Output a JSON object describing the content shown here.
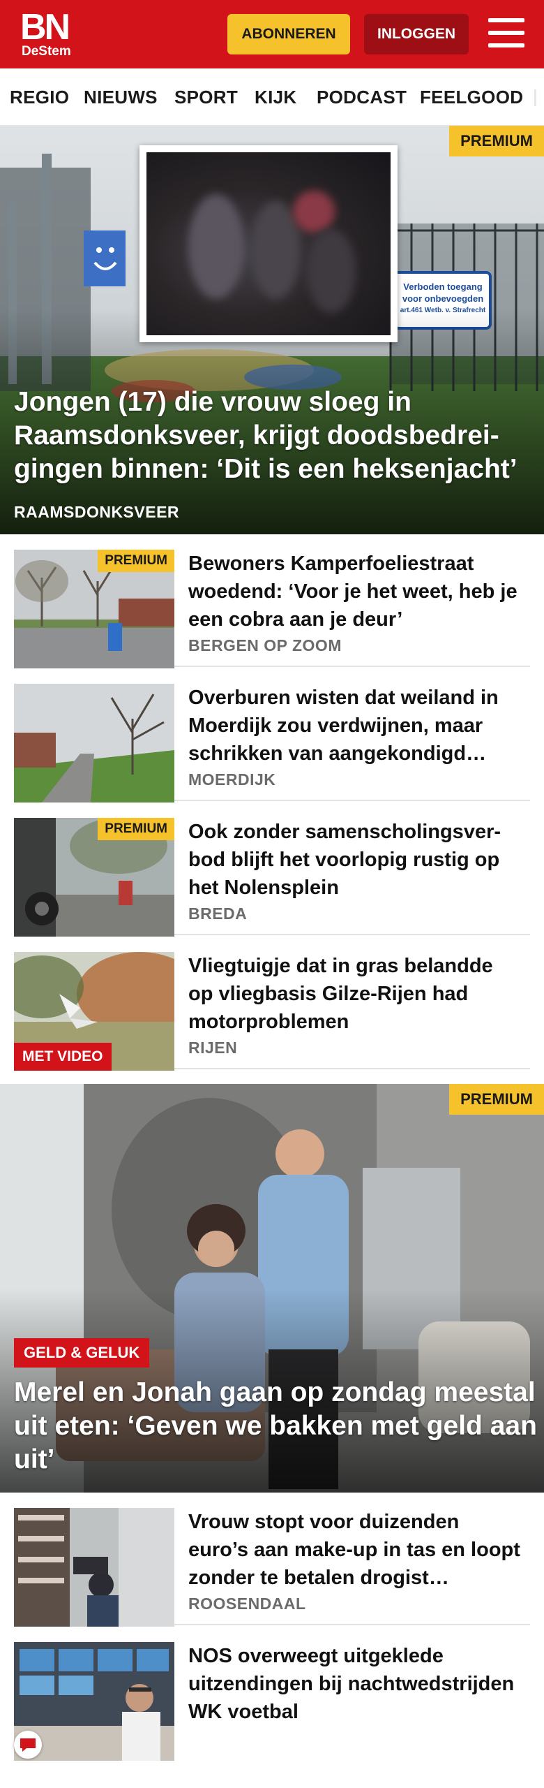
{
  "header": {
    "logo_main": "BN",
    "logo_sub": "DeStem",
    "subscribe_label": "ABONNEREN",
    "login_label": "INLOGGEN",
    "brand_color": "#d2131a",
    "accent_color": "#f6c22c"
  },
  "nav": {
    "items": [
      "REGIO",
      "NIEUWS",
      "SPORT",
      "KIJK",
      "PODCAST",
      "FEELGOOD"
    ]
  },
  "hero": {
    "badge": "PREMIUM",
    "title": "Jongen (17) die vrouw sloeg in Raamsdonksveer, krijgt doodsbedrei­gingen binnen: ‘Dit is een heksenjacht’",
    "location": "RAAMSDONKSVEER",
    "sign_text": [
      "Verboden toegang",
      "voor onbevoegden",
      "art.461 Wetb. v. Strafrecht"
    ]
  },
  "articles": [
    {
      "badge": "PREMIUM",
      "title": "Bewoners Kamperfoeliestraat woedend: ‘Voor je het weet, heb je een cobra aan je deur’",
      "location": "BERGEN OP ZOOM"
    },
    {
      "badge": "",
      "title": "Overburen wisten dat weiland in Moerdijk zou verdwijnen, maar schrikken van aangekondigd…",
      "location": "MOERDIJK"
    },
    {
      "badge": "PREMIUM",
      "title": "Ook zonder samenscholingsver­bod blijft het voorlopig rustig op het Nolensplein",
      "location": "BREDA"
    },
    {
      "badge": "MET VIDEO",
      "title": "Vliegtuigje dat in gras belandde op vliegbasis Gilze-Rijen had motorproblemen",
      "location": "RIJEN"
    }
  ],
  "hero2": {
    "badge": "PREMIUM",
    "section": "GELD & GELUK",
    "title": "Merel en Jonah gaan op zondag meestal uit eten: ‘Geven we bakken met geld aan uit’"
  },
  "articles2": [
    {
      "title": "Vrouw stopt voor duizenden euro’s aan make-up in tas en loopt zonder te betalen drogist…",
      "location": "ROOSENDAAL"
    },
    {
      "title": "NOS overweegt uitgeklede uitzendingen bij nachtwedstrij­den WK voetbal",
      "location": ""
    }
  ]
}
